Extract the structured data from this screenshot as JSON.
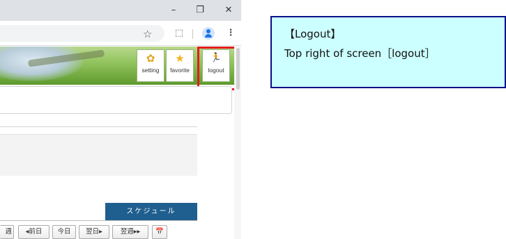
{
  "browser": {
    "window_controls": {
      "minimize": "–",
      "maximize": "❐",
      "close": "✕"
    },
    "toolbar": {
      "bookmark_icon": "☆",
      "extensions_icon": "⬚",
      "menu_icon": "⋮"
    }
  },
  "app": {
    "header_nav": [
      {
        "id": "setting",
        "label": "setting",
        "icon": "gear-icon",
        "glyph": "✿"
      },
      {
        "id": "favorite",
        "label": "favorite",
        "icon": "star-icon",
        "glyph": "★"
      },
      {
        "id": "logout",
        "label": "logout",
        "icon": "running-person-icon",
        "glyph": "🏃"
      }
    ],
    "schedule_tab": "スケジュール",
    "date_nav": {
      "prev_week": "週",
      "prev_day": "◂前日",
      "today": "今日",
      "next_day": "翌日▸",
      "next_week": "翌週▸▸",
      "calendar_icon": "📅"
    }
  },
  "callout": {
    "title": "【Logout】",
    "text": "Top right of screen［logout］"
  },
  "colors": {
    "highlight": "#e31d1d",
    "callout_bg": "#ccffff",
    "callout_border": "#0a0f86",
    "schedule_tab": "#1f5f8f"
  }
}
